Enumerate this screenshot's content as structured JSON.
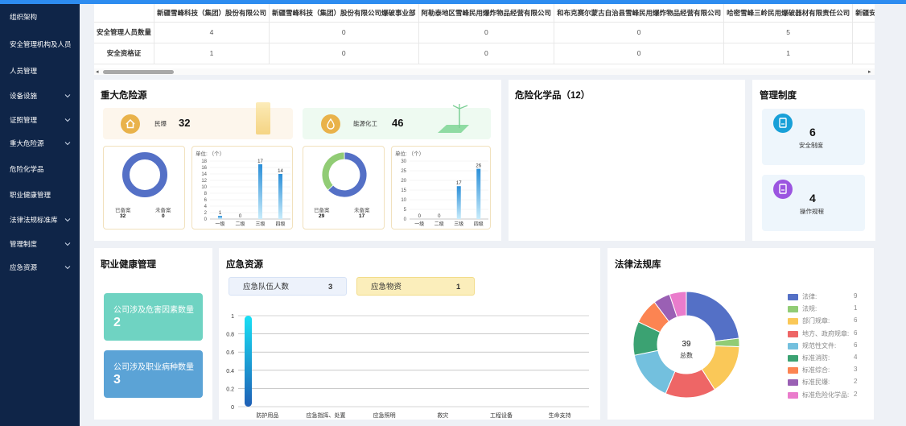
{
  "sidebar": {
    "items": [
      {
        "label": "组织架构",
        "chevron": false
      },
      {
        "label": "安全管理机构及人员",
        "chevron": false
      },
      {
        "label": "人员管理",
        "chevron": false
      },
      {
        "label": "设备设施",
        "chevron": true
      },
      {
        "label": "证照管理",
        "chevron": true
      },
      {
        "label": "重大危险源",
        "chevron": true
      },
      {
        "label": "危险化学品",
        "chevron": false
      },
      {
        "label": "职业健康管理",
        "chevron": false
      },
      {
        "label": "法律法规标准库",
        "chevron": true
      },
      {
        "label": "管理制度",
        "chevron": true
      },
      {
        "label": "应急资源",
        "chevron": true
      }
    ]
  },
  "table": {
    "columns": [
      "新疆雪峰科技（集团）股份有限公司",
      "新疆雪峰科技（集团）股份有限公司爆破事业部",
      "阿勒泰地区雪峰民用爆炸物品经营有限公司",
      "和布克赛尔蒙古自治县雪峰民用爆炸物品经营有限公司",
      "哈密雪峰三岭民用爆破器材有限责任公司",
      "新疆安顺达矿"
    ],
    "rows": [
      {
        "label": "安全管理人员数量",
        "values": [
          "4",
          "0",
          "0",
          "0",
          "5",
          ""
        ]
      },
      {
        "label": "安全资格证",
        "values": [
          "1",
          "0",
          "0",
          "0",
          "1",
          ""
        ]
      }
    ]
  },
  "hazard": {
    "title": "重大危险源",
    "cat1": {
      "label": "民爆",
      "value": "32"
    },
    "cat2": {
      "label": "能源化工",
      "value": "46"
    },
    "donut1": {
      "filed_label": "已备案",
      "filed": "32",
      "unfiled_label": "未备案",
      "unfiled": "0"
    },
    "donut2": {
      "filed_label": "已备案",
      "filed": "29",
      "unfiled_label": "未备案",
      "unfiled": "17"
    },
    "bar1": {
      "unit": "单位: （个）"
    },
    "bar2": {
      "unit": "单位: （个）"
    }
  },
  "hazchem": {
    "title": "危险化学品（12）"
  },
  "mgmt": {
    "title": "管理制度",
    "card1": {
      "value": "6",
      "label": "安全制度"
    },
    "card2": {
      "value": "4",
      "label": "操作规程"
    }
  },
  "oh": {
    "title": "职业健康管理",
    "card1": {
      "label": "公司涉及危害因素数量",
      "value": "2"
    },
    "card2": {
      "label": "公司涉及职业病种数量",
      "value": "3"
    }
  },
  "emergency": {
    "title": "应急资源",
    "pill1": {
      "label": "应急队伍人数",
      "value": "3"
    },
    "pill2": {
      "label": "应急物资",
      "value": "1"
    }
  },
  "law": {
    "title": "法律法规库",
    "total": "39",
    "total_label": "总数"
  },
  "colors": {
    "sidebar": "#0f2548",
    "accent": "#2d8cf0",
    "teal": "#6fd3c2",
    "blue": "#5ba3d6"
  },
  "chart_data": [
    {
      "type": "pie",
      "title": "",
      "labels": [
        "已备案",
        "未备案"
      ],
      "values": [
        32,
        0
      ],
      "colors": [
        "#5470c6",
        "#91cc75"
      ]
    },
    {
      "type": "bar",
      "title": "",
      "ylabel": "单位: （个）",
      "categories": [
        "一级",
        "二级",
        "三级",
        "四级"
      ],
      "values": [
        1,
        0,
        17,
        14
      ],
      "ylim": [
        0,
        18
      ],
      "yticks": [
        0,
        2,
        4,
        6,
        8,
        10,
        12,
        14,
        16,
        18
      ]
    },
    {
      "type": "pie",
      "title": "",
      "labels": [
        "已备案",
        "未备案"
      ],
      "values": [
        29,
        17
      ],
      "colors": [
        "#5470c6",
        "#91cc75"
      ]
    },
    {
      "type": "bar",
      "title": "",
      "ylabel": "单位: （个）",
      "categories": [
        "一级",
        "二级",
        "三级",
        "四级"
      ],
      "values": [
        0,
        0,
        17,
        26
      ],
      "ylim": [
        0,
        30
      ],
      "yticks": [
        0,
        5,
        10,
        15,
        20,
        25,
        30
      ]
    },
    {
      "type": "bar",
      "title": "",
      "categories": [
        "防护用品",
        "应急指挥、处置",
        "应急照明",
        "救灾",
        "工程设备",
        "生命支持"
      ],
      "values": [
        1,
        0,
        0,
        0,
        0,
        0
      ],
      "ylim": [
        0,
        1
      ],
      "yticks": [
        0,
        0.2,
        0.4,
        0.6,
        0.8,
        1
      ]
    },
    {
      "type": "pie",
      "title": "",
      "labels": [
        "法律:",
        "法规:",
        "部门规章:",
        "地方、政府规章:",
        "规范性文件:",
        "标准消防:",
        "标准综合:",
        "标准民爆:",
        "标准危险化学品:"
      ],
      "values": [
        9,
        1,
        6,
        6,
        6,
        4,
        3,
        2,
        2
      ],
      "colors": [
        "#5470c6",
        "#91cc75",
        "#fac858",
        "#ee6666",
        "#73c0de",
        "#3ba272",
        "#fc8452",
        "#9a60b4",
        "#ea7ccc"
      ]
    }
  ]
}
